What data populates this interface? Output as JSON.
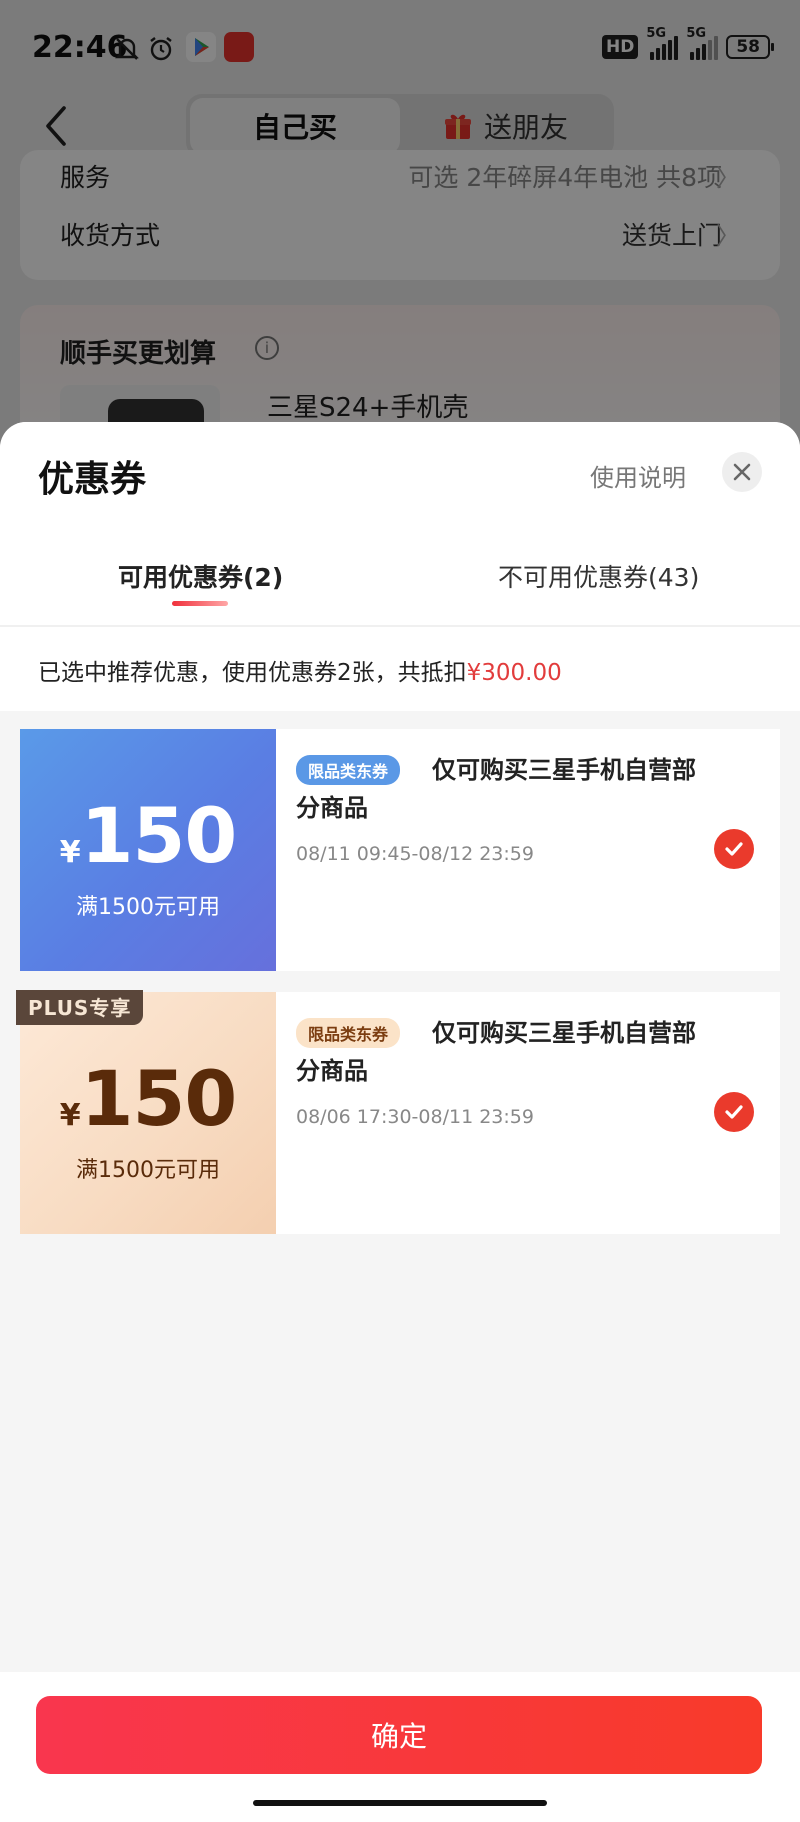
{
  "status_bar": {
    "time": "22:46",
    "hd": "HD",
    "network_1": "5G",
    "network_2": "5G",
    "battery": "58"
  },
  "nav": {
    "tab_self": "自己买",
    "tab_gift": "送朋友"
  },
  "background": {
    "service_label": "服务",
    "service_value": "可选 2年碎屏4年电池 共8项",
    "delivery_label": "收货方式",
    "delivery_value": "送货上门",
    "addon_title": "顺手买更划算",
    "addon_product": "三星S24+手机壳"
  },
  "sheet": {
    "title": "优惠券",
    "help": "使用说明",
    "tabs": {
      "available": "可用优惠券(2)",
      "unavailable": "不可用优惠券(43)"
    },
    "summary_prefix": "已选中推荐优惠，使用优惠券2张，共抵扣",
    "summary_amount": "¥300.00"
  },
  "coupons": [
    {
      "currency": "¥",
      "amount": "150",
      "threshold": "满1500元可用",
      "badge": "限品类东券",
      "description": "仅可购买三星手机自营部分商品",
      "validity": "08/11 09:45-08/12 23:59"
    },
    {
      "tag": "PLUS专享",
      "currency": "¥",
      "amount": "150",
      "threshold": "满1500元可用",
      "badge": "限品类东券",
      "description": "仅可购买三星手机自营部分商品",
      "validity": "08/06 17:30-08/11 23:59"
    }
  ],
  "footer": {
    "confirm": "确定"
  },
  "colors": {
    "accent_red": "#ea3a2c",
    "coupon_blue": "#5a8ae6",
    "coupon_gold": "#f8dcc3"
  }
}
